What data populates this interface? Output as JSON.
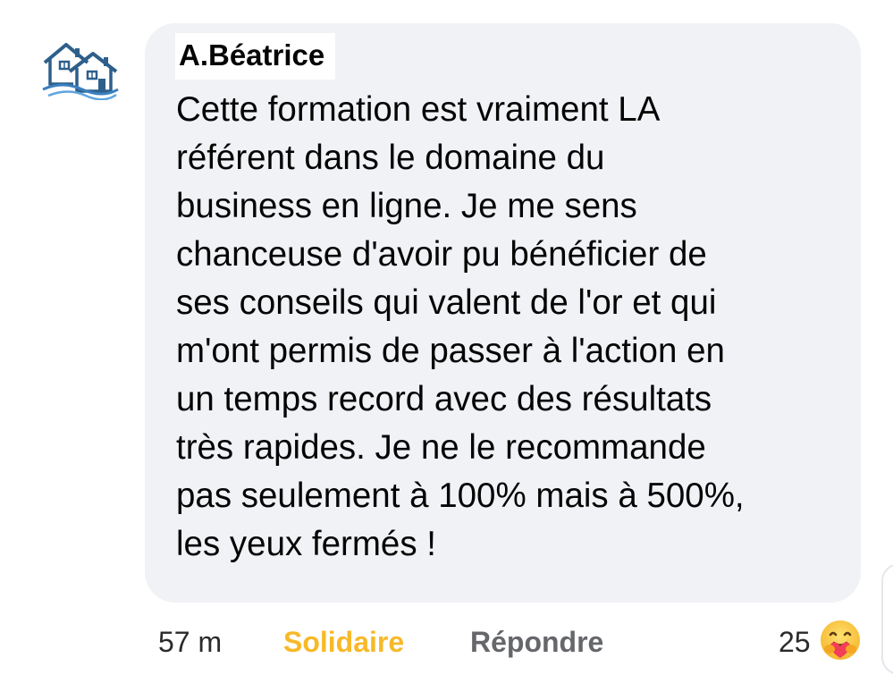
{
  "comment": {
    "author": "A.Béatrice",
    "avatar_icon": "houses-logo-icon",
    "text": "Cette formation est vraiment LA\nréférent dans le domaine du\nbusiness en ligne. Je me sens\nchanceuse d'avoir pu bénéficier de\nses conseils qui valent de l'or et qui\nm'ont permis de passer à l'action en\nun temps record avec des résultats\ntrès rapides. Je ne le recommande\npas seulement à 100% mais à 500%,\nles yeux fermés !"
  },
  "actions": {
    "timestamp": "57 m",
    "react_label": "Solidaire",
    "reply_label": "Répondre"
  },
  "reactions": {
    "count": "25",
    "emoji_icon": "care-hug-emoji-icon"
  },
  "colors": {
    "bubble_bg": "#f0f2f5",
    "react_active": "#f7b928",
    "secondary_text": "#65676b",
    "logo_blue": "#2d5f8a"
  }
}
